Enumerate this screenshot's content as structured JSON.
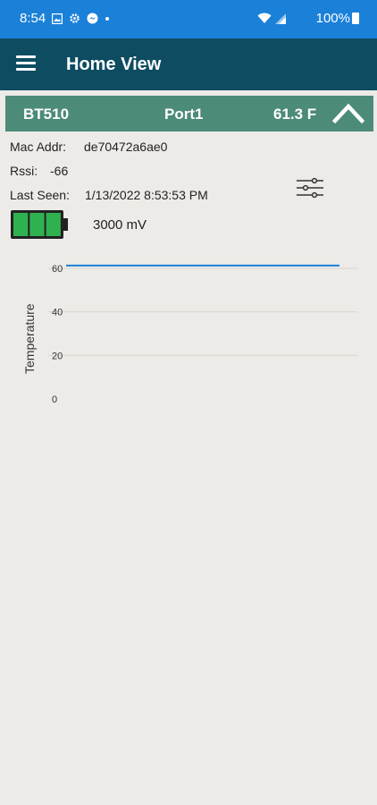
{
  "status_bar": {
    "time": "8:54",
    "battery": "100%",
    "icons": [
      "image-icon",
      "settings-gear-icon",
      "messenger-icon",
      "dot-icon",
      "wifi-icon",
      "signal-icon",
      "battery-icon"
    ]
  },
  "app_bar": {
    "title": "Home View",
    "menu_icon": "hamburger-menu-icon"
  },
  "sensor": {
    "name": "BT510",
    "port": "Port1",
    "temperature": "61.3 F",
    "mac_label": "Mac Addr:",
    "mac_value": "de70472a6ae0",
    "rssi_label": "Rssi:",
    "rssi_value": "-66",
    "last_seen_label": "Last Seen:",
    "last_seen_value": "1/13/2022 8:53:53 PM",
    "battery_mv": "3000 mV",
    "battery_level": 1.0,
    "colors": {
      "header": "#4c8b7a",
      "battery": "#2eb24f"
    }
  },
  "chart_data": {
    "type": "line",
    "title": "",
    "xlabel": "",
    "ylabel": "Temperature",
    "ylim": [
      0,
      60
    ],
    "y_ticks": [
      "60",
      "40",
      "20",
      "0"
    ],
    "grid": true,
    "series": [
      {
        "values": [
          61.3,
          61.3
        ]
      }
    ],
    "line_color": "#1b80d8"
  }
}
